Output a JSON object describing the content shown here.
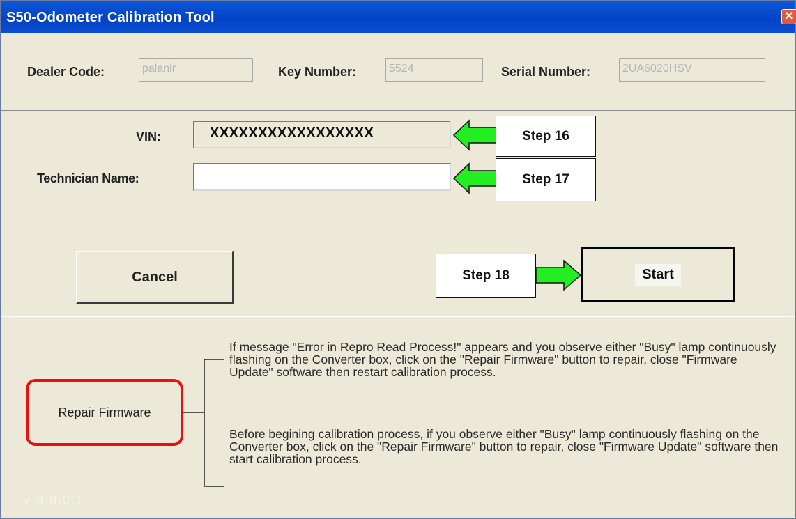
{
  "window": {
    "title": "S50-Odometer Calibration Tool",
    "close_glyph": "✕"
  },
  "header_fields": {
    "dealer_code_label": "Dealer Code:",
    "dealer_code_value": "palanir",
    "key_number_label": "Key Number:",
    "key_number_value": "5524",
    "serial_number_label": "Serial Number:",
    "serial_number_value": "2UA6020HSV"
  },
  "form": {
    "vin_label": "VIN:",
    "vin_value": "XXXXXXXXXXXXXXXXX",
    "technician_label": "Technician Name:",
    "technician_value": ""
  },
  "steps": {
    "step16": "Step 16",
    "step17": "Step 17",
    "step18": "Step 18"
  },
  "buttons": {
    "cancel": "Cancel",
    "start": "Start",
    "repair_firmware": "Repair Firmware"
  },
  "notes": {
    "note1": "If message \"Error in Repro Read Process!\" appears and you observe either \"Busy\" lamp continuously flashing on the Converter box, click on the \"Repair Firmware\" button to repair, close \"Firmware Update\" software then restart calibration process.",
    "note2": "Before begining calibration process, if you observe either \"Busy\" lamp continuously flashing on the Converter box, click on the \"Repair Firmware\" button to repair, close \"Firmware Update\" software then start calibration process."
  },
  "version": "V 4.0.0.1",
  "colors": {
    "titlebar": "#0a4fd0",
    "arrow_green": "#22ee22",
    "highlight_red": "#e8110f",
    "dialog_bg": "#ece9d8"
  },
  "icons": {
    "close": "close-icon",
    "arrow_left": "arrow-left-icon",
    "arrow_right": "arrow-right-icon"
  }
}
